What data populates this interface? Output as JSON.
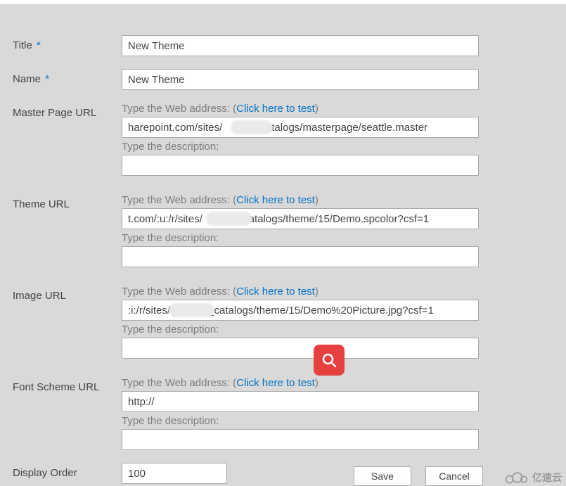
{
  "fields": {
    "title": {
      "label": "Title",
      "required": "*",
      "value": "New Theme"
    },
    "name": {
      "label": "Name",
      "required": "*",
      "value": "New Theme"
    },
    "displayOrder": {
      "label": "Display Order",
      "value": "100"
    }
  },
  "urlFields": {
    "masterPage": {
      "label": "Master Page URL",
      "value": "harepoint.com/sites/          /_catalogs/masterpage/seattle.master"
    },
    "theme": {
      "label": "Theme URL",
      "value": "t.com/:u:/r/sites/           /_catalogs/theme/15/Demo.spcolor?csf=1"
    },
    "image": {
      "label": "Image URL",
      "value": ":i:/r/sites/            /_catalogs/theme/15/Demo%20Picture.jpg?csf=1"
    },
    "fontScheme": {
      "label": "Font Scheme URL",
      "value": "http://"
    }
  },
  "hints": {
    "webAddressPrefix": "Type the Web address: (",
    "webAddressSuffix": ")",
    "testLink": "Click here to test",
    "description": "Type the description:"
  },
  "buttons": {
    "save": "Save",
    "cancel": "Cancel"
  },
  "watermark": "亿速云"
}
